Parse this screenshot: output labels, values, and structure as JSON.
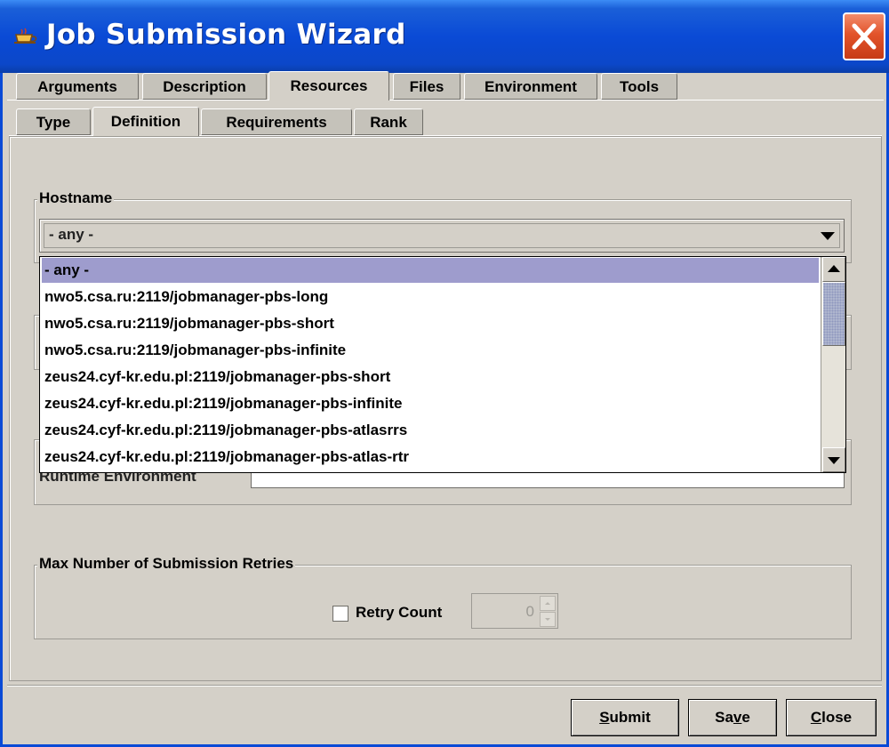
{
  "window": {
    "title": "Job Submission Wizard"
  },
  "tabs": {
    "main": [
      "Arguments",
      "Description",
      "Resources",
      "Files",
      "Environment",
      "Tools"
    ],
    "sub": [
      "Type",
      "Definition",
      "Requirements",
      "Rank"
    ]
  },
  "hostname": {
    "group_label": "Hostname",
    "selected": "- any -",
    "options": [
      "- any -",
      "nwo5.csa.ru:2119/jobmanager-pbs-long",
      "nwo5.csa.ru:2119/jobmanager-pbs-short",
      "nwo5.csa.ru:2119/jobmanager-pbs-infinite",
      "zeus24.cyf-kr.edu.pl:2119/jobmanager-pbs-short",
      "zeus24.cyf-kr.edu.pl:2119/jobmanager-pbs-infinite",
      "zeus24.cyf-kr.edu.pl:2119/jobmanager-pbs-atlasrrs",
      "zeus24.cyf-kr.edu.pl:2119/jobmanager-pbs-atlas-rtr"
    ]
  },
  "runtime": {
    "label": "Runtime Environment",
    "value": ""
  },
  "retries": {
    "group_label": "Max Number of Submission Retries",
    "checkbox_label": "Retry Count",
    "checked": false,
    "value": "0"
  },
  "buttons": {
    "submit_first": "S",
    "submit_rest": "ubmit",
    "save_first": "Sa",
    "save_u": "v",
    "save_rest": "e",
    "close_first": "C",
    "close_rest": "lose"
  },
  "colors": {
    "title_bar": "#0a4ad6",
    "close_button": "#e2532a",
    "dialog_bg": "#d4d0c8",
    "selection": "#9e9ccd"
  }
}
